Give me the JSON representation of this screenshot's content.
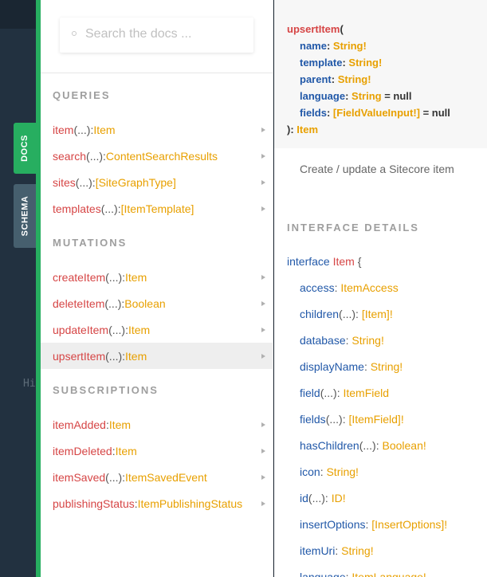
{
  "background": {
    "hint": "Hi"
  },
  "side_tabs": {
    "docs": "DOCS",
    "schema": "SCHEMA"
  },
  "search": {
    "placeholder": "Search the docs ..."
  },
  "sections": {
    "queries": "QUERIES",
    "mutations": "MUTATIONS",
    "subscriptions": "SUBSCRIPTIONS"
  },
  "queries": [
    {
      "name": "item",
      "args": "(...)",
      "colon": ": ",
      "type": "Item"
    },
    {
      "name": "search",
      "args": "(...)",
      "colon": ": ",
      "type": "ContentSearchResults"
    },
    {
      "name": "sites",
      "args": "(...)",
      "colon": ": ",
      "type": "[SiteGraphType]"
    },
    {
      "name": "templates",
      "args": "(...)",
      "colon": ": ",
      "type": "[ItemTemplate]"
    }
  ],
  "mutations": [
    {
      "name": "createItem",
      "args": "(...)",
      "colon": ": ",
      "type": "Item"
    },
    {
      "name": "deleteItem",
      "args": "(...)",
      "colon": ": ",
      "type": "Boolean"
    },
    {
      "name": "updateItem",
      "args": "(...)",
      "colon": ": ",
      "type": "Item"
    },
    {
      "name": "upsertItem",
      "args": "(...)",
      "colon": ": ",
      "type": "Item"
    }
  ],
  "subscriptions": [
    {
      "name": "itemAdded",
      "args": "",
      "colon": ": ",
      "type": "Item"
    },
    {
      "name": "itemDeleted",
      "args": "",
      "colon": ": ",
      "type": "Item"
    },
    {
      "name": "itemSaved",
      "args": "(...)",
      "colon": ": ",
      "type": "ItemSavedEvent"
    },
    {
      "name": "publishingStatus",
      "args": "",
      "colon": ": ",
      "type": "ItemPublishingStatus"
    }
  ],
  "detail": {
    "signature": {
      "fn": "upsertItem",
      "open": "(",
      "args": [
        {
          "name": "name",
          "type": "String!",
          "suffix": ""
        },
        {
          "name": "template",
          "type": "String!",
          "suffix": ""
        },
        {
          "name": "parent",
          "type": "String!",
          "suffix": ""
        },
        {
          "name": "language",
          "type": "String",
          "suffix": " = null"
        },
        {
          "name": "fields",
          "type": "[FieldValueInput!]",
          "suffix": " = null"
        }
      ],
      "close": "): ",
      "return_type": "Item"
    },
    "description": "Create / update a Sitecore item",
    "interface_title": "INTERFACE DETAILS",
    "interface_kw": "interface ",
    "interface_name": "Item",
    "interface_brace": " {",
    "fields": [
      {
        "name": "access",
        "args": "",
        "type": "ItemAccess"
      },
      {
        "name": "children",
        "args": "(...)",
        "type": "[Item]!"
      },
      {
        "name": "database",
        "args": "",
        "type": "String!"
      },
      {
        "name": "displayName",
        "args": "",
        "type": "String!"
      },
      {
        "name": "field",
        "args": "(...)",
        "type": "ItemField"
      },
      {
        "name": "fields",
        "args": "(...)",
        "type": "[ItemField]!"
      },
      {
        "name": "hasChildren",
        "args": "(...)",
        "type": "Boolean!"
      },
      {
        "name": "icon",
        "args": "",
        "type": "String!"
      },
      {
        "name": "id",
        "args": "(...)",
        "type": "ID!"
      },
      {
        "name": "insertOptions",
        "args": "",
        "type": "[InsertOptions]!"
      },
      {
        "name": "itemUri",
        "args": "",
        "type": "String!"
      },
      {
        "name": "language",
        "args": "",
        "type": "ItemLanguage!"
      }
    ]
  },
  "colors": {
    "accent_green": "#27ae60",
    "function_red": "#d64545",
    "type_orange": "#e8a000",
    "arg_blue": "#2158a8"
  }
}
